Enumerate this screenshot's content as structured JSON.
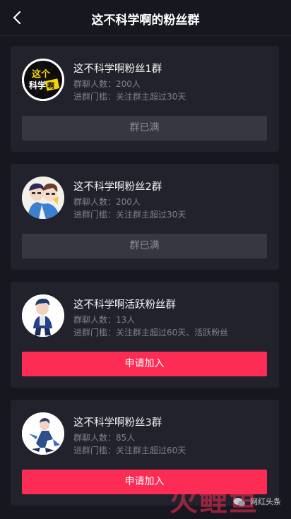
{
  "header": {
    "title": "这不科学啊的粉丝群"
  },
  "groups": [
    {
      "name": "这不科学啊粉丝1群",
      "members": "群聊人数：200人",
      "threshold": "进群门槛：关注群主超过30天",
      "button": "群已满"
    },
    {
      "name": "这不科学啊粉丝2群",
      "members": "群聊人数：200人",
      "threshold": "进群门槛：关注群主超过30天",
      "button": "群已满"
    },
    {
      "name": "这不科学啊活跃粉丝群",
      "members": "群聊人数：13人",
      "threshold": "进群门槛：关注群主超过60天、活跃粉丝",
      "button": "申请加入"
    },
    {
      "name": "这不科学啊粉丝3群",
      "members": "群聊人数：85人",
      "threshold": "进群门槛：关注群主超过60天",
      "button": "申请加入"
    }
  ],
  "avatar1_text": {
    "line1": "这个",
    "line2": "科学",
    "line3": "啊"
  },
  "watermark": {
    "big": "火鲤鱼",
    "small": "网红头条"
  },
  "colors": {
    "accent": "#fd2c55",
    "background": "#16171f",
    "card": "#21222b",
    "full_button": "#363740"
  }
}
